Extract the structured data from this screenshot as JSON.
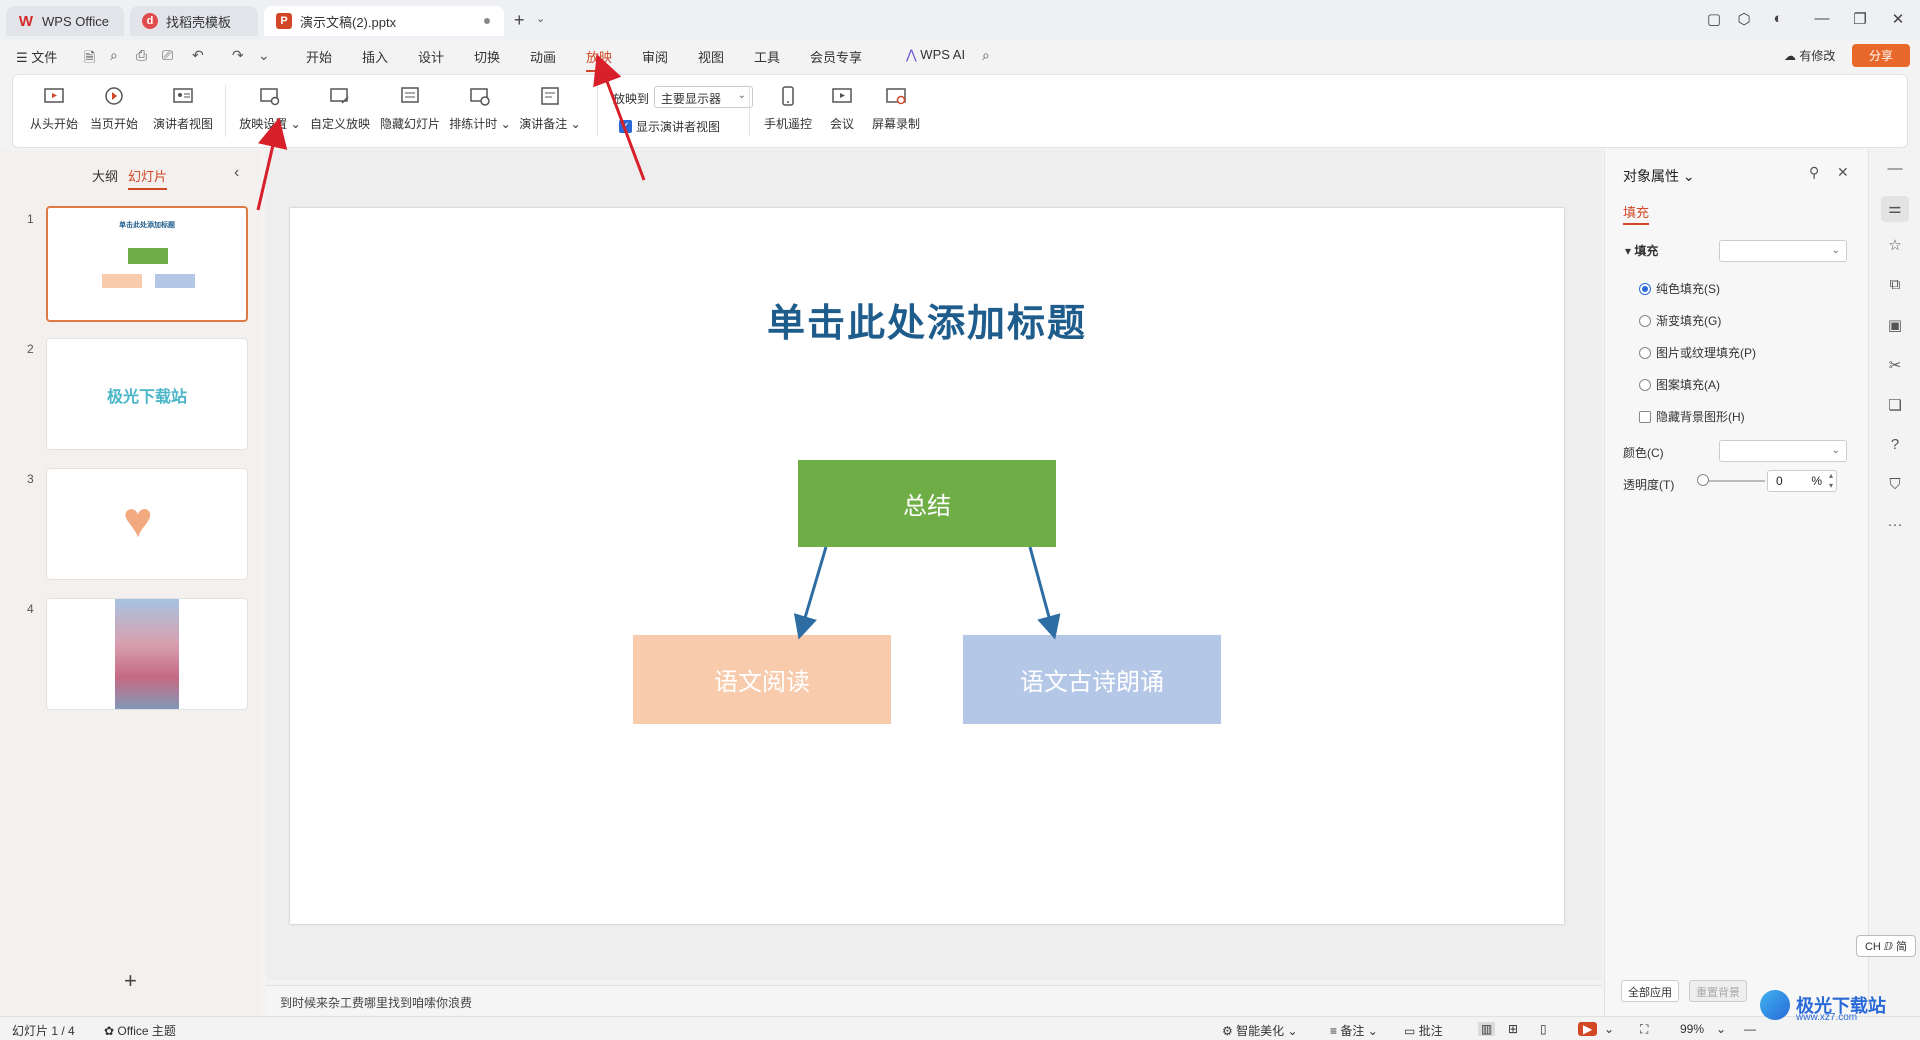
{
  "titlebar": {
    "tabs": [
      {
        "label": "WPS Office"
      },
      {
        "label": "找稻壳模板"
      },
      {
        "label": "演示文稿(2).pptx"
      }
    ]
  },
  "menu": {
    "file": "文件",
    "items": [
      "开始",
      "插入",
      "设计",
      "切换",
      "动画",
      "放映",
      "审阅",
      "视图",
      "工具",
      "会员专享"
    ],
    "active": "放映",
    "wps_ai": "WPS AI",
    "modify": "有修改",
    "share": "分享"
  },
  "ribbon": {
    "buttons": [
      {
        "label": "从头开始"
      },
      {
        "label": "当页开始"
      },
      {
        "label": "演讲者视图"
      },
      {
        "label": "放映设置"
      },
      {
        "label": "自定义放映"
      },
      {
        "label": "隐藏幻灯片"
      },
      {
        "label": "排练计时"
      },
      {
        "label": "演讲备注"
      },
      {
        "label": "手机遥控"
      },
      {
        "label": "会议"
      },
      {
        "label": "屏幕录制"
      }
    ],
    "play_to_label": "放映到",
    "monitor_value": "主要显示器",
    "presenter_view_check": "显示演讲者视图"
  },
  "left_panel": {
    "tab_outline": "大纲",
    "tab_slides": "幻灯片",
    "slides": [
      {
        "num": "1"
      },
      {
        "num": "2",
        "text": "极光下载站"
      },
      {
        "num": "3"
      },
      {
        "num": "4"
      }
    ]
  },
  "slide": {
    "title": "单击此处添加标题",
    "box_top": "总结",
    "box_left": "语文阅读",
    "box_right": "语文古诗朗诵",
    "colors": {
      "green": "#6fad46",
      "peach": "#f7cbac",
      "blue": "#b4c7e7",
      "title": "#1e5c8c"
    }
  },
  "notes": {
    "text": "到时候来杂工费哪里找到咱嗦你浪费"
  },
  "right_panel": {
    "title": "对象属性",
    "tab_fill": "填充",
    "fill_section": "填充",
    "options": [
      {
        "label": "纯色填充(S)",
        "checked": true
      },
      {
        "label": "渐变填充(G)",
        "checked": false
      },
      {
        "label": "图片或纹理填充(P)",
        "checked": false
      },
      {
        "label": "图案填充(A)",
        "checked": false
      }
    ],
    "hide_bg": "隐藏背景图形(H)",
    "color_label": "颜色(C)",
    "opacity_label": "透明度(T)",
    "opacity_value": "0",
    "opacity_unit": "%",
    "apply_all": "全部应用",
    "reset_bg": "重置背景"
  },
  "ime": "CH ⅅ 简",
  "statusbar": {
    "slide_count": "幻灯片 1 / 4",
    "theme": "Office 主题",
    "beautify": "智能美化",
    "notes": "备注",
    "comments": "批注",
    "zoom": "99%"
  },
  "watermark": {
    "text": "极光下载站",
    "url": "www.xz7.com"
  }
}
